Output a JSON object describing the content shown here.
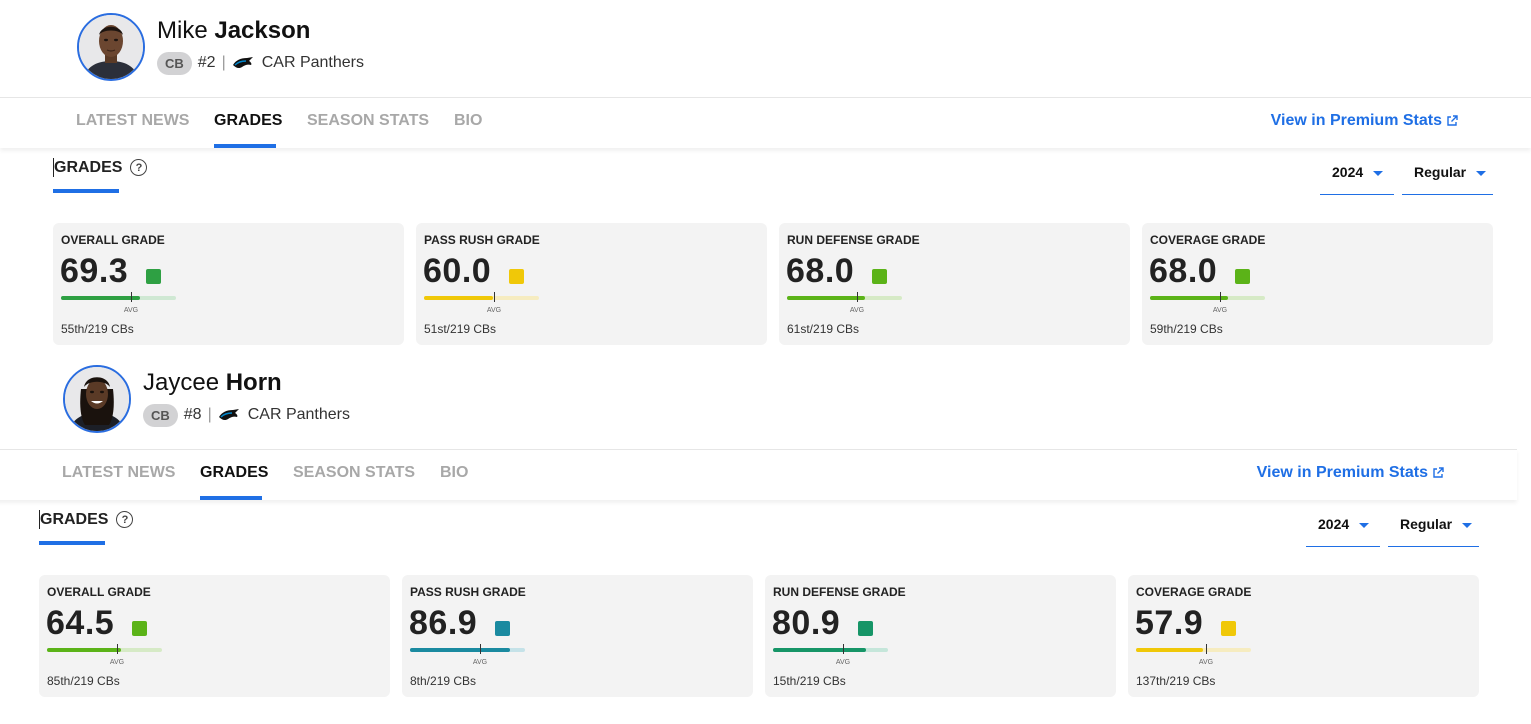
{
  "players": [
    {
      "first_name": "Mike",
      "last_name": "Jackson",
      "position": "CB",
      "number": "#2",
      "team": "CAR Panthers",
      "tabs": [
        "LATEST NEWS",
        "GRADES",
        "SEASON STATS",
        "BIO"
      ],
      "active_tab": "GRADES",
      "premium_link": "View in Premium Stats",
      "section_title": "GRADES",
      "help_icon": "?",
      "year": "2024",
      "season_type": "Regular",
      "grades": [
        {
          "title": "OVERALL GRADE",
          "value": "69.3",
          "fraction": 0.69,
          "color": "#2ea043",
          "track": "#cfe8d3",
          "avg": "AVG",
          "rank": "55th/219 CBs"
        },
        {
          "title": "PASS RUSH GRADE",
          "value": "60.0",
          "fraction": 0.6,
          "color": "#f0c808",
          "track": "#f6ecc0",
          "avg": "AVG",
          "rank": "51st/219 CBs"
        },
        {
          "title": "RUN DEFENSE GRADE",
          "value": "68.0",
          "fraction": 0.68,
          "color": "#5bb318",
          "track": "#d6eac6",
          "avg": "AVG",
          "rank": "61st/219 CBs"
        },
        {
          "title": "COVERAGE GRADE",
          "value": "68.0",
          "fraction": 0.68,
          "color": "#5bb318",
          "track": "#d6eac6",
          "avg": "AVG",
          "rank": "59th/219 CBs"
        }
      ]
    },
    {
      "first_name": "Jaycee",
      "last_name": "Horn",
      "position": "CB",
      "number": "#8",
      "team": "CAR Panthers",
      "tabs": [
        "LATEST NEWS",
        "GRADES",
        "SEASON STATS",
        "BIO"
      ],
      "active_tab": "GRADES",
      "premium_link": "View in Premium Stats",
      "section_title": "GRADES",
      "help_icon": "?",
      "year": "2024",
      "season_type": "Regular",
      "grades": [
        {
          "title": "OVERALL GRADE",
          "value": "64.5",
          "fraction": 0.645,
          "color": "#5bb318",
          "track": "#d6eac6",
          "avg": "AVG",
          "rank": "85th/219 CBs"
        },
        {
          "title": "PASS RUSH GRADE",
          "value": "86.9",
          "fraction": 0.87,
          "color": "#1a8aa0",
          "track": "#c5e2e8",
          "avg": "AVG",
          "rank": "8th/219 CBs"
        },
        {
          "title": "RUN DEFENSE GRADE",
          "value": "80.9",
          "fraction": 0.81,
          "color": "#169567",
          "track": "#c5e6da",
          "avg": "AVG",
          "rank": "15th/219 CBs"
        },
        {
          "title": "COVERAGE GRADE",
          "value": "57.9",
          "fraction": 0.58,
          "color": "#f0c808",
          "track": "#f6ecc0",
          "avg": "AVG",
          "rank": "137th/219 CBs"
        }
      ]
    }
  ]
}
